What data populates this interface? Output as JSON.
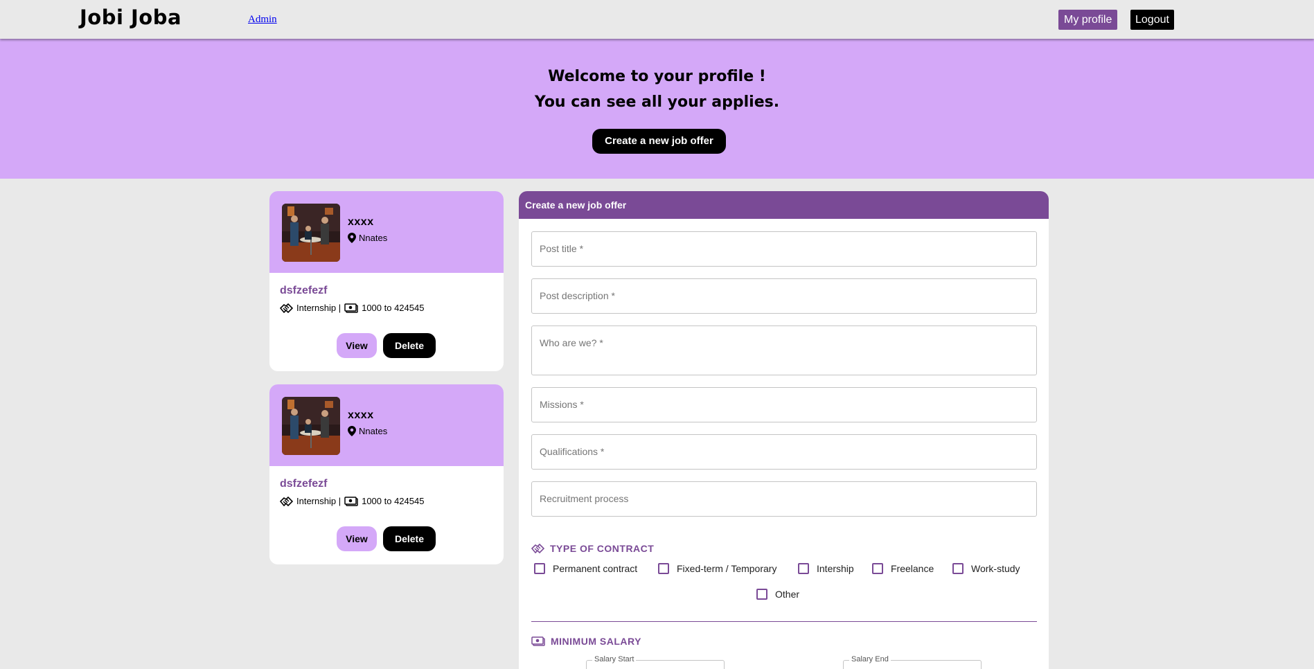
{
  "header": {
    "brand": "Jobi Joba",
    "admin_link": "Admin",
    "my_profile": "My profile",
    "logout": "Logout"
  },
  "hero": {
    "line1": "Welcome to your profile !",
    "line2": "You can see all your applies.",
    "create_button": "Create a new job offer"
  },
  "jobs": [
    {
      "company": "xxxx",
      "location": "Nnates",
      "title": "dsfzefezf",
      "contract": "Internship |",
      "salary": "1000 to 424545",
      "view": "View",
      "delete": "Delete"
    },
    {
      "company": "xxxx",
      "location": "Nnates",
      "title": "dsfzefezf",
      "contract": "Internship |",
      "salary": "1000 to 424545",
      "view": "View",
      "delete": "Delete"
    }
  ],
  "form": {
    "title": "Create a new job offer",
    "fields": {
      "post_title": "Post title *",
      "post_description": "Post description *",
      "who_are_we": "Who are we? *",
      "missions": "Missions *",
      "qualifications": "Qualifications *",
      "recruitment_process": "Recruitment process"
    },
    "contract_section": "TYPE OF CONTRACT",
    "contracts": [
      "Permanent contract",
      "Fixed-term / Temporary",
      "Intership",
      "Freelance",
      "Work-study",
      "Other"
    ],
    "salary_section": "MINIMUM SALARY",
    "salary_start": "Salary Start",
    "salary_end": "Salary End"
  },
  "colors": {
    "accent": "#7a4a96",
    "lavender": "#d4a8f8",
    "background": "#e9e9e9"
  },
  "icons": [
    "location-pin-icon",
    "handshake-icon",
    "money-icon"
  ]
}
